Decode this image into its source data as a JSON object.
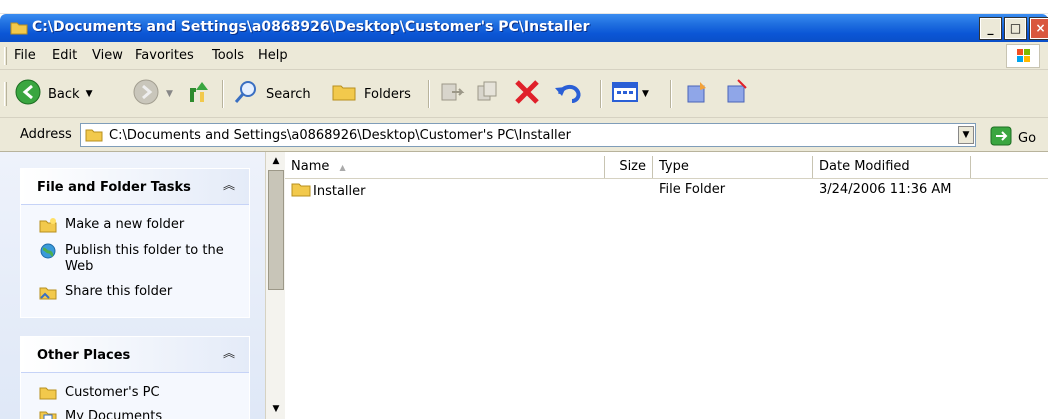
{
  "window": {
    "title": "C:\\Documents and Settings\\a0868926\\Desktop\\Customer's PC\\Installer",
    "minimize": "_",
    "maximize": "□",
    "close": "×"
  },
  "menu": {
    "items": [
      "File",
      "Edit",
      "View",
      "Favorites",
      "Tools",
      "Help"
    ]
  },
  "toolbar": {
    "back_label": "Back",
    "search_label": "Search",
    "folders_label": "Folders"
  },
  "address": {
    "label": "Address",
    "value": "C:\\Documents and Settings\\a0868926\\Desktop\\Customer's PC\\Installer",
    "go_label": "Go"
  },
  "tasks": {
    "file_folder_title": "File and Folder Tasks",
    "items": [
      "Make a new folder",
      "Publish this folder to the Web",
      "Share this folder"
    ],
    "other_places_title": "Other Places",
    "places": [
      "Customer's PC",
      "My Documents"
    ]
  },
  "list": {
    "columns": [
      "Name",
      "Size",
      "Type",
      "Date Modified"
    ],
    "rows": [
      {
        "name": "Installer",
        "size": "",
        "type": "File Folder",
        "modified": "3/24/2006 11:36 AM"
      }
    ]
  },
  "colors": {
    "title_bar": "#0b56d6",
    "chrome": "#ece9d8",
    "task_pane": "#dfe8f7"
  }
}
